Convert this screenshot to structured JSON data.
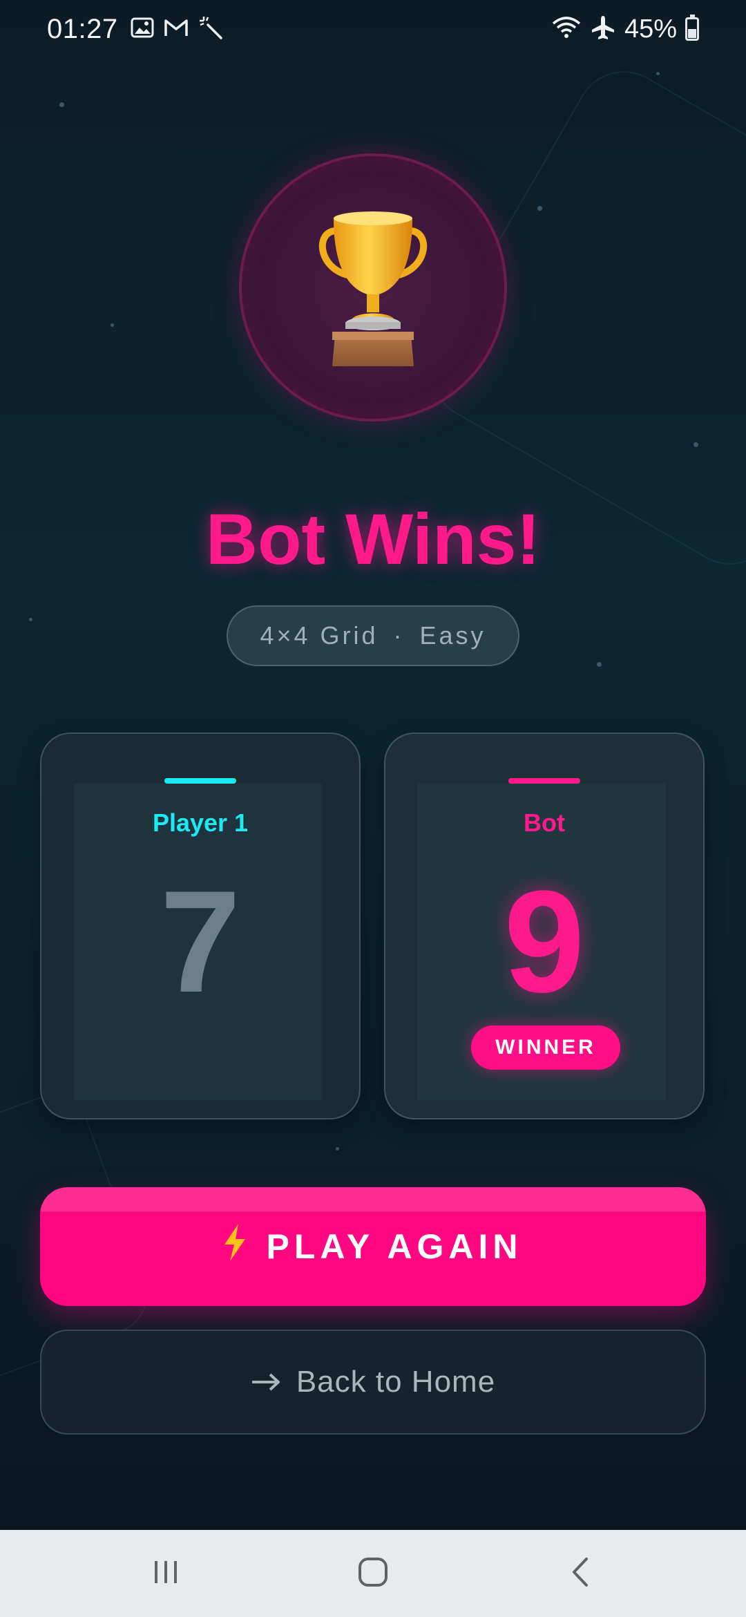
{
  "status_bar": {
    "time": "01:27",
    "battery_percent": "45%",
    "battery_level": 0.45,
    "left_icons": [
      "gallery-icon",
      "gmail-icon",
      "magic-wand-icon"
    ],
    "right_icons": [
      "wifi-icon",
      "airplane-mode-icon",
      "battery-icon"
    ]
  },
  "result": {
    "title": "Bot Wins!",
    "trophy_icon": "trophy-icon",
    "grid_label": "4×4 Grid",
    "separator": "·",
    "difficulty": "Easy"
  },
  "players": [
    {
      "name": "Player 1",
      "score": "7",
      "accent": "#1de9f2",
      "score_color": "#6c7f86"
    },
    {
      "name": "Bot",
      "score": "9",
      "accent": "#ff1a8c",
      "score_color": "#ff1a8c",
      "badge": "WINNER"
    }
  ],
  "actions": {
    "play_again_label": "PLAY AGAIN",
    "play_again_icon": "lightning-icon",
    "home_label": "Back to Home",
    "home_icon": "arrow-right-icon"
  },
  "colors": {
    "accent_pink": "#ff0780",
    "accent_cyan": "#1de9f2",
    "background": "#0c2632"
  },
  "nav_bar": {
    "buttons": [
      "recent-apps-icon",
      "home-icon",
      "back-icon"
    ]
  }
}
